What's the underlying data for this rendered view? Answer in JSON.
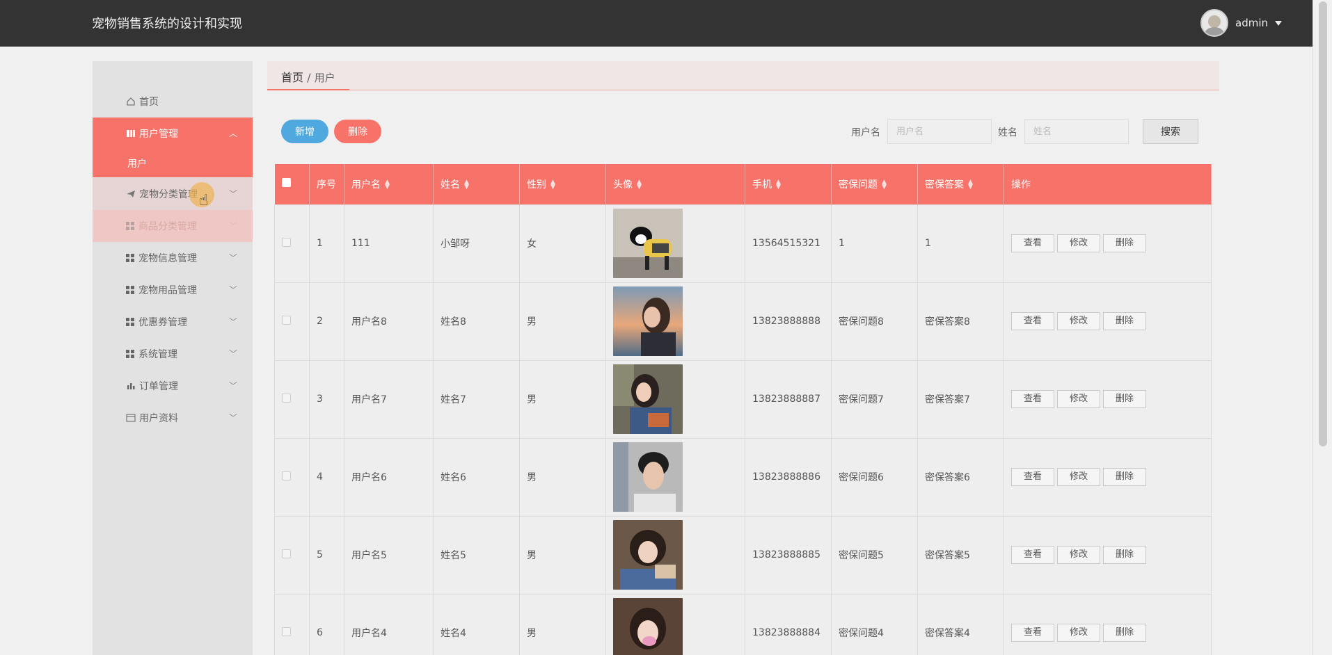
{
  "header": {
    "title": "宠物销售系统的设计和实现",
    "user": "admin"
  },
  "sidebar": {
    "home": "首页",
    "user_mgmt": "用户管理",
    "user_sub": "用户",
    "pet_category": "宠物分类管理",
    "goods_category": "商品分类管理",
    "pet_info": "宠物信息管理",
    "pet_supplies": "宠物用品管理",
    "coupon": "优惠券管理",
    "system": "系统管理",
    "orders": "订单管理",
    "profile": "用户资料"
  },
  "breadcrumb": {
    "home": "首页",
    "sep": "/",
    "current": "用户"
  },
  "toolbar": {
    "add_label": "新增",
    "delete_label": "删除",
    "username_label": "用户名",
    "username_placeholder": "用户名",
    "name_label": "姓名",
    "name_placeholder": "姓名",
    "search_label": "搜索"
  },
  "table": {
    "headers": [
      "序号",
      "用户名",
      "姓名",
      "性别",
      "头像",
      "手机",
      "密保问题",
      "密保答案",
      "操作"
    ],
    "actions": {
      "view": "查看",
      "edit": "修改",
      "delete": "删除"
    },
    "rows": [
      {
        "index": "1",
        "username": "111",
        "name": "小邹呀",
        "gender": "女",
        "phone": "13564515321",
        "question": "1",
        "answer": "1"
      },
      {
        "index": "2",
        "username": "用户名8",
        "name": "姓名8",
        "gender": "男",
        "phone": "13823888888",
        "question": "密保问题8",
        "answer": "密保答案8"
      },
      {
        "index": "3",
        "username": "用户名7",
        "name": "姓名7",
        "gender": "男",
        "phone": "13823888887",
        "question": "密保问题7",
        "answer": "密保答案7"
      },
      {
        "index": "4",
        "username": "用户名6",
        "name": "姓名6",
        "gender": "男",
        "phone": "13823888886",
        "question": "密保问题6",
        "answer": "密保答案6"
      },
      {
        "index": "5",
        "username": "用户名5",
        "name": "姓名5",
        "gender": "男",
        "phone": "13823888885",
        "question": "密保问题5",
        "answer": "密保答案5"
      },
      {
        "index": "6",
        "username": "用户名4",
        "name": "姓名4",
        "gender": "男",
        "phone": "13823888884",
        "question": "密保问题4",
        "answer": "密保答案4"
      }
    ]
  },
  "colors": {
    "accent": "#f7736a",
    "blue": "#4fa9df",
    "topbar": "#333333"
  }
}
